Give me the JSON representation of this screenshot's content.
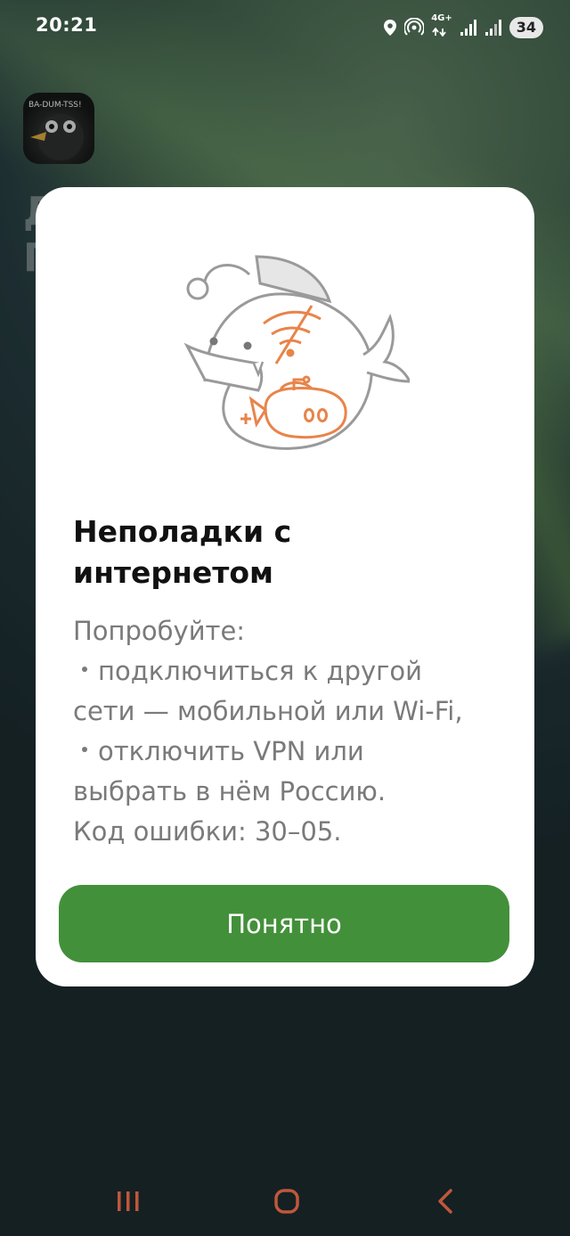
{
  "status_bar": {
    "time": "20:21",
    "network_label": "4G+",
    "battery": "34"
  },
  "background_app": {
    "title_line1": "Д",
    "title_line2": "П",
    "avatar_text": "BA-DUM-TSS!"
  },
  "dialog": {
    "title_line1": "Неполадки с",
    "title_line2": "интернетом",
    "body": {
      "intro": "Попробуйте:",
      "bullet1_line1": "подключиться к другой",
      "bullet1_line2": "сети — мобильной или Wi-Fi,",
      "bullet2_line1": "отключить VPN или",
      "bullet2_line2": "выбрать в нём Россию.",
      "error_code": "Код ошибки: 30–05."
    },
    "button_label": "Понятно"
  },
  "colors": {
    "accent": "#43903a",
    "illustration_orange": "#e8844a",
    "illustration_gray": "#9a9a9a",
    "nav_icon": "#c0573a"
  },
  "icons": {
    "status": [
      "location-icon",
      "hotspot-icon",
      "signal-icon",
      "signal-icon-2"
    ],
    "nav": [
      "recent-apps-icon",
      "home-icon",
      "back-icon"
    ]
  }
}
